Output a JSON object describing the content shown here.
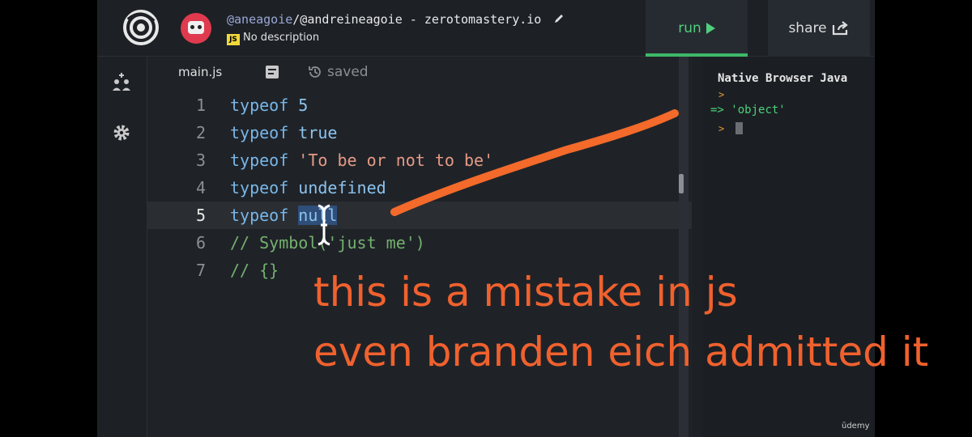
{
  "header": {
    "user_handle": "@aneagoie",
    "repl_path": "/@andreineagoie - zerotomastery.io",
    "lang_badge": "JS",
    "description": "No description",
    "run_label": "run",
    "share_label": "share"
  },
  "tabs": {
    "file": "main.js",
    "status": "saved"
  },
  "code_lines": [
    {
      "n": "1",
      "kw": "typeof",
      "rest": "5"
    },
    {
      "n": "2",
      "kw": "typeof",
      "rest": "true"
    },
    {
      "n": "3",
      "kw": "typeof",
      "rest": "'To be or not to be'"
    },
    {
      "n": "4",
      "kw": "typeof",
      "rest": "undefined"
    },
    {
      "n": "5",
      "kw": "typeof",
      "rest": "null"
    },
    {
      "n": "6",
      "comment": "// Symbol('just me')"
    },
    {
      "n": "7",
      "comment": "// {}"
    }
  ],
  "console": {
    "title": "Native Browser Java",
    "prompt": ">",
    "arrow": "=>",
    "result": "'object'"
  },
  "annotation": {
    "line1": "this is a mistake in js",
    "line2": "even branden eich admitted it"
  },
  "watermark": "ūdemy",
  "colors": {
    "accent_run": "#4fcf7b",
    "annotation": "#f0612e",
    "avatar": "#e03a4e"
  }
}
